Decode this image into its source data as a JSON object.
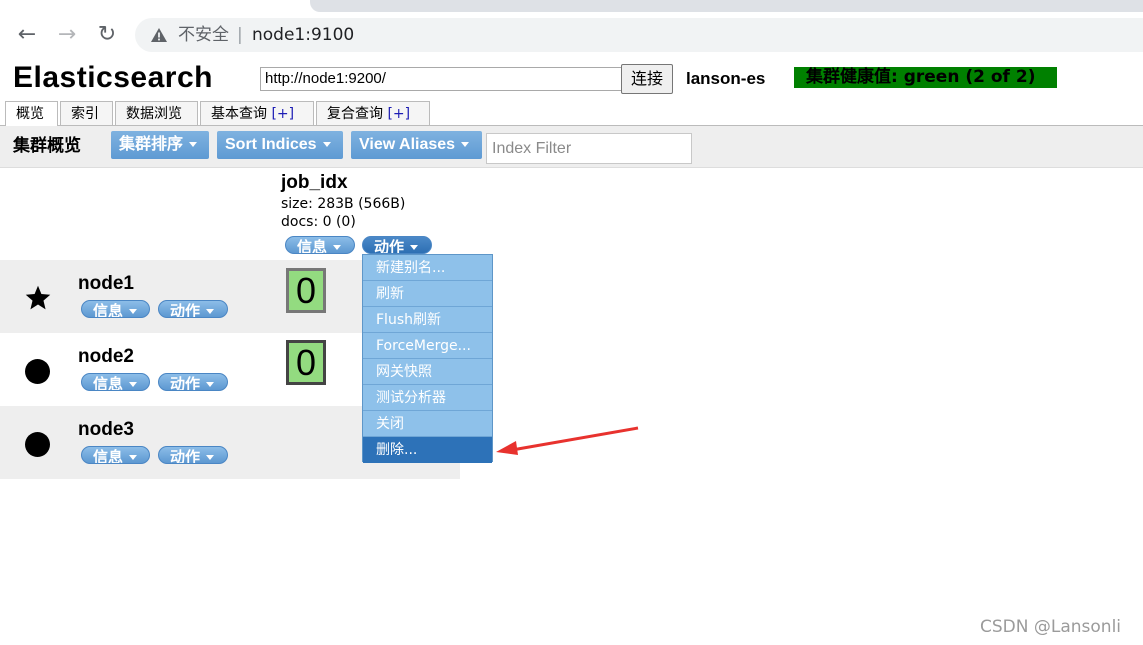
{
  "browser": {
    "security_label": "不安全",
    "separator": "|",
    "url": "node1:9100"
  },
  "app": {
    "title": "Elasticsearch",
    "es_url": "http://node1:9200/",
    "connect_label": "连接",
    "cluster_name": "lanson-es",
    "health": "集群健康值: green (2 of 2)",
    "health_color": "#008000"
  },
  "tabs": [
    {
      "label": "概览",
      "plus": ""
    },
    {
      "label": "索引",
      "plus": ""
    },
    {
      "label": "数据浏览",
      "plus": ""
    },
    {
      "label": "基本查询",
      "plus": "[+]"
    },
    {
      "label": "复合查询",
      "plus": "[+]"
    }
  ],
  "toolbar": {
    "title": "集群概览",
    "sort_cluster": "集群排序",
    "sort_indices": "Sort Indices",
    "view_aliases": "View Aliases",
    "index_filter_placeholder": "Index Filter"
  },
  "index": {
    "name": "job_idx",
    "size": "size: 283B (566B)",
    "docs": "docs: 0 (0)",
    "info_label": "信息",
    "action_label": "动作"
  },
  "nodes": [
    {
      "name": "node1",
      "icon": "star-icon",
      "info_label": "信息",
      "action_label": "动作",
      "shard": "0"
    },
    {
      "name": "node2",
      "icon": "circle-icon",
      "info_label": "信息",
      "action_label": "动作",
      "shard": "0"
    },
    {
      "name": "node3",
      "icon": "circle-icon",
      "info_label": "信息",
      "action_label": "动作",
      "shard": ""
    }
  ],
  "action_menu": [
    "新建别名...",
    "刷新",
    "Flush刷新",
    "ForceMerge...",
    "网关快照",
    "测试分析器",
    "关闭",
    "删除..."
  ],
  "colors": {
    "accent": "#5e9ad3",
    "shard_green": "#93db80",
    "annotation_arrow": "#e8322e"
  },
  "watermark": "CSDN @Lansonli"
}
